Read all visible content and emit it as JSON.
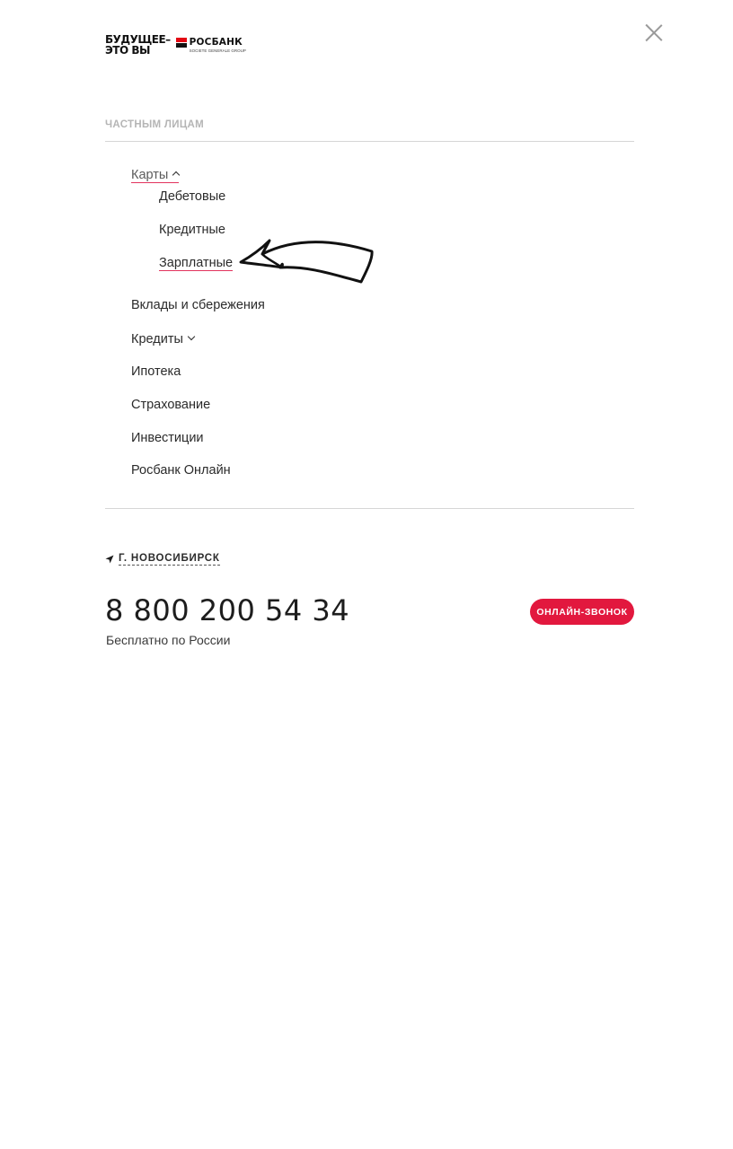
{
  "logo": {
    "slogan_line1": "БУДУЩЕЕ–",
    "slogan_line2": "ЭТО ВЫ",
    "brand": "РОСБАНК",
    "subtitle": "SOCIETE GENERALE GROUP",
    "colors": {
      "red": "#e30613",
      "black": "#111111"
    }
  },
  "close_icon": "close-icon",
  "section": {
    "title": "ЧАСТНЫМ ЛИЦАМ"
  },
  "menu": {
    "cards": {
      "label": "Карты",
      "expanded": true,
      "children": [
        "Дебетовые",
        "Кредитные",
        "Зарплатные"
      ],
      "active_child": "Зарплатные"
    },
    "deposits": "Вклады и сбережения",
    "credits": {
      "label": "Кредиты",
      "expanded": false
    },
    "mortgage": "Ипотека",
    "insurance": "Страхование",
    "investments": "Инвестиции",
    "online": "Росбанк Онлайн"
  },
  "annotation": {
    "icon": "hand-drawn-arrow-icon"
  },
  "location": {
    "icon": "location-arrow-icon",
    "city": "Г. НОВОСИБИРСК"
  },
  "contact": {
    "phone": "8 800 200 54 34",
    "note": "Бесплатно по России",
    "call_button": "ОНЛАЙН-ЗВОНОК",
    "accent_color": "#e2183e"
  }
}
